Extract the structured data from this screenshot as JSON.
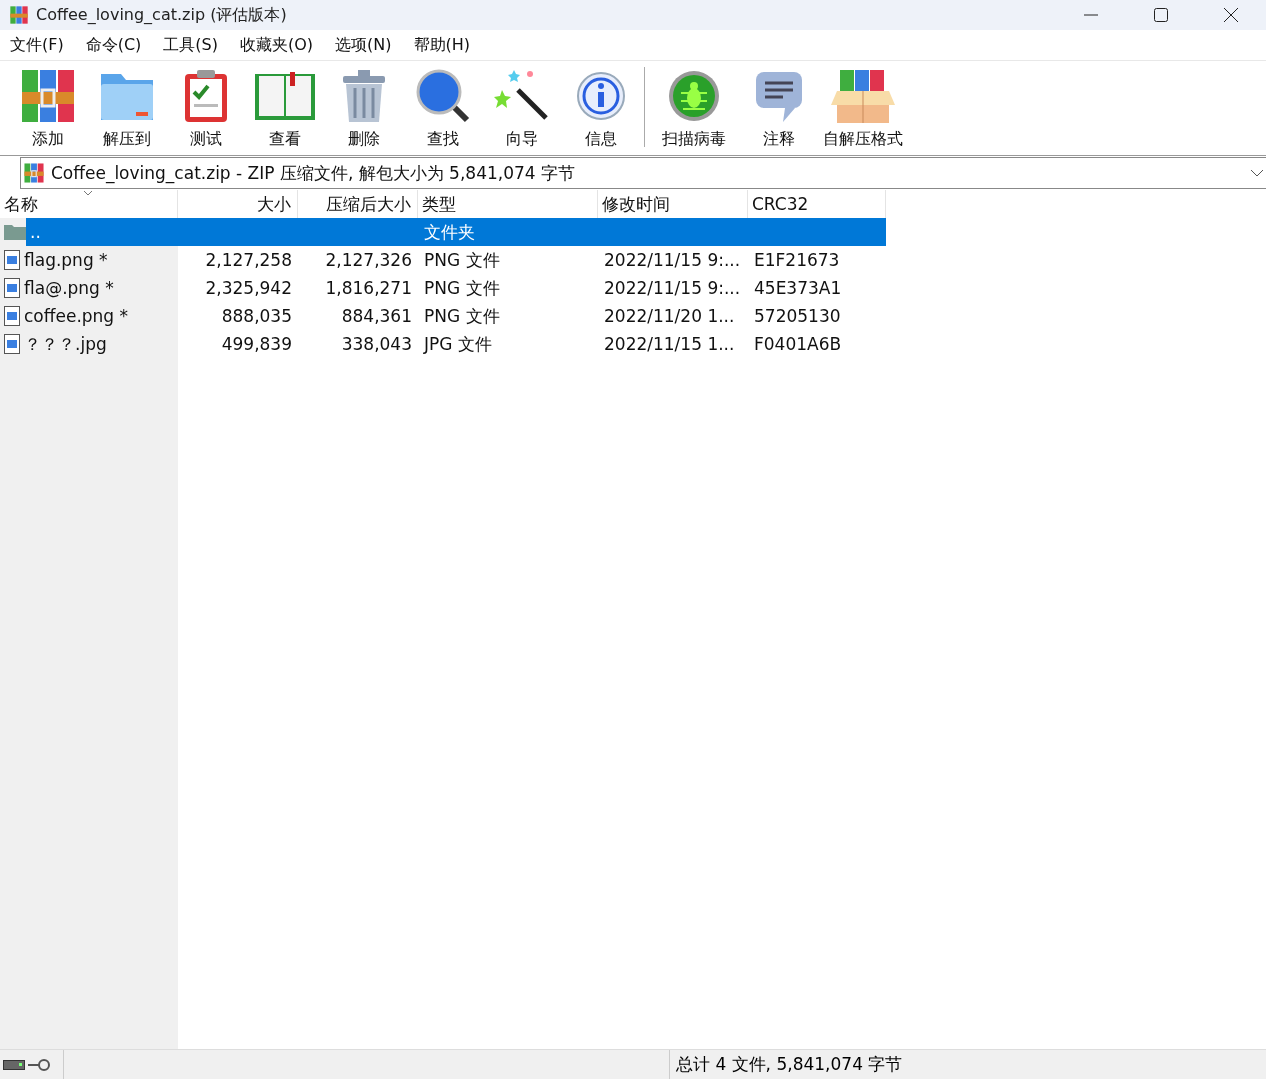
{
  "window": {
    "title": "Coffee_loving_cat.zip (评估版本)"
  },
  "menu": [
    "文件(F)",
    "命令(C)",
    "工具(S)",
    "收藏夹(O)",
    "选项(N)",
    "帮助(H)"
  ],
  "toolbar": [
    {
      "label": "添加",
      "kind": "books"
    },
    {
      "label": "解压到",
      "kind": "folder"
    },
    {
      "label": "测试",
      "kind": "clipboard"
    },
    {
      "label": "查看",
      "kind": "book"
    },
    {
      "label": "删除",
      "kind": "trash"
    },
    {
      "label": "查找",
      "kind": "magnifier"
    },
    {
      "label": "向导",
      "kind": "wand"
    },
    {
      "label": "信息",
      "kind": "info"
    },
    {
      "label": "扫描病毒",
      "kind": "bug"
    },
    {
      "label": "注释",
      "kind": "comment"
    },
    {
      "label": "自解压格式",
      "kind": "box"
    }
  ],
  "address": {
    "value": "Coffee_loving_cat.zip - ZIP 压缩文件, 解包大小为 5,841,074 字节"
  },
  "table": {
    "columns": [
      "名称",
      "大小",
      "压缩后大小",
      "类型",
      "修改时间",
      "CRC32"
    ],
    "rows": [
      {
        "kind": "folder",
        "name": "..",
        "size": "",
        "packed": "",
        "type": "文件夹",
        "modified": "",
        "crc": "",
        "selected": true
      },
      {
        "kind": "file",
        "name": "flag.png *",
        "size": "2,127,258",
        "packed": "2,127,326",
        "type": "PNG 文件",
        "modified": "2022/11/15 9:...",
        "crc": "E1F21673",
        "selected": false
      },
      {
        "kind": "file",
        "name": "fla@.png *",
        "size": "2,325,942",
        "packed": "1,816,271",
        "type": "PNG 文件",
        "modified": "2022/11/15 9:...",
        "crc": "45E373A1",
        "selected": false
      },
      {
        "kind": "file",
        "name": "coffee.png *",
        "size": "888,035",
        "packed": "884,361",
        "type": "PNG 文件",
        "modified": "2022/11/20 1...",
        "crc": "57205130",
        "selected": false
      },
      {
        "kind": "file",
        "name": "？？？.jpg",
        "size": "499,839",
        "packed": "338,043",
        "type": "JPG 文件",
        "modified": "2022/11/15 1...",
        "crc": "F0401A6B",
        "selected": false
      }
    ]
  },
  "status_bar": {
    "text": "总计 4 文件, 5,841,074 字节"
  }
}
